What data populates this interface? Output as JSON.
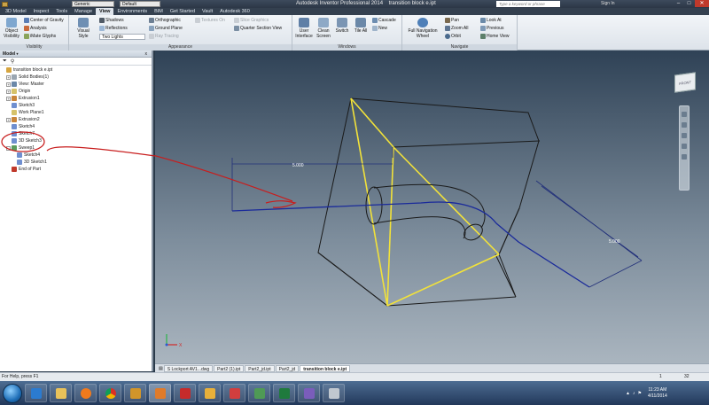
{
  "title_bar": {
    "app_title": "Autodesk Inventor Professional 2014",
    "document_title": "transition block e.ipt",
    "appearance_dropdown": "Generic",
    "style_dropdown": "Default",
    "search_placeholder": "Type a keyword or phrase",
    "sign_in": "Sign In"
  },
  "tabs": [
    "3D Model",
    "Inspect",
    "Tools",
    "Manage",
    "View",
    "Environments",
    "BIM",
    "Get Started",
    "Vault",
    "Autodesk 360"
  ],
  "active_tab": "View",
  "ribbon": {
    "visibility": {
      "label": "Visibility",
      "object_visibility": "Object Visibility",
      "center_of_gravity": "Center of Gravity",
      "analysis": "Analysis",
      "imate_glyphs": "iMate Glyphs"
    },
    "appearance": {
      "label": "Appearance",
      "visual_style": "Visual Style",
      "shadows": "Shadows",
      "reflections": "Reflections",
      "lighting": "Two Lights",
      "orthographic": "Orthographic",
      "ground_plane": "Ground Plane",
      "ray_tracing": "Ray Tracing",
      "texture_on": "Textures On",
      "slice_graphics": "Slice Graphics",
      "quarter_section": "Quarter Section View"
    },
    "windows": {
      "label": "Windows",
      "user_interface": "User Interface",
      "clean_screen": "Clean Screen",
      "switch": "Switch",
      "tile_all": "Tile All",
      "cascade": "Cascade",
      "new": "New"
    },
    "navigate": {
      "label": "Navigate",
      "full_nav_wheel": "Full Navigation Wheel",
      "pan": "Pan",
      "zoom_all": "Zoom All",
      "orbit": "Orbit",
      "look_at": "Look At",
      "previous": "Previous",
      "home_view": "Home View"
    }
  },
  "browser": {
    "header": "Model",
    "close": "x",
    "tree": [
      {
        "label": "transition block e.ipt",
        "level": 0,
        "expander": ""
      },
      {
        "label": "Solid Bodies(1)",
        "level": 1,
        "expander": "+"
      },
      {
        "label": "View: Master",
        "level": 1,
        "expander": "+"
      },
      {
        "label": "Origin",
        "level": 1,
        "expander": "+"
      },
      {
        "label": "Extrusion1",
        "level": 1,
        "expander": "+"
      },
      {
        "label": "Sketch3",
        "level": 1,
        "expander": ""
      },
      {
        "label": "Work Plane1",
        "level": 1,
        "expander": ""
      },
      {
        "label": "Extrusion2",
        "level": 1,
        "expander": "+"
      },
      {
        "label": "Sketch4",
        "level": 1,
        "expander": ""
      },
      {
        "label": "Sketch7",
        "level": 1,
        "expander": ""
      },
      {
        "label": "3D Sketch3",
        "level": 1,
        "expander": ""
      },
      {
        "label": "Sweep1",
        "level": 1,
        "expander": "-"
      },
      {
        "label": "Sketch4",
        "level": 2,
        "expander": ""
      },
      {
        "label": "3D Sketch1",
        "level": 2,
        "expander": ""
      },
      {
        "label": "End of Part",
        "level": 1,
        "expander": ""
      }
    ]
  },
  "viewport": {
    "viewcube_label": "FRONT",
    "dimension_1": "5.000",
    "dimension_2": "5.000",
    "triad_x": "X"
  },
  "document_tabs": [
    {
      "label": "S Lockport AV1...dwg",
      "active": false
    },
    {
      "label": "Part2 (1).ipt",
      "active": false
    },
    {
      "label": "Part2_jd.ipt",
      "active": false
    },
    {
      "label": "Part2_jd",
      "active": false
    },
    {
      "label": "transition block e.ipt",
      "active": true
    }
  ],
  "status_bar": {
    "help_text": "For Help, press F1",
    "count_1": "1",
    "count_2": "32"
  },
  "taskbar": {
    "clock_time": "11:23 AM",
    "clock_date": "4/11/2014"
  }
}
